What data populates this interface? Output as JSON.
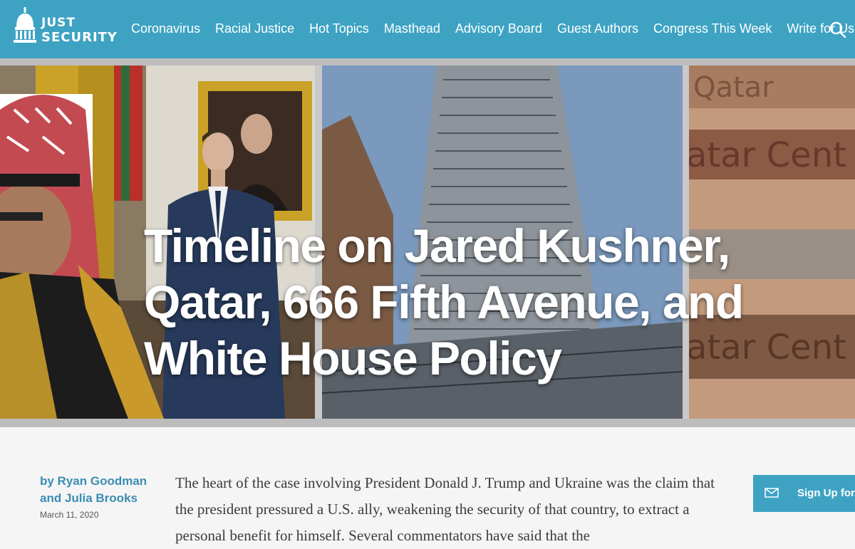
{
  "header": {
    "logo_line1": "JUST",
    "logo_line2": "SECURITY",
    "nav": [
      "Coronavirus",
      "Racial Justice",
      "Hot Topics",
      "Masthead",
      "Advisory Board",
      "Guest Authors",
      "Congress This Week",
      "Write for Us"
    ],
    "search_icon": "search-icon",
    "bar_color": "#3ea3c3"
  },
  "hero": {
    "title": "Timeline on Jared Kushner, Qatar, 666 Fifth Avenue, and White House Policy",
    "panel3_text1": "Qatar",
    "panel3_text2": "atar Cent",
    "panel3_text3": "atar Cent"
  },
  "article": {
    "byline": "by Ryan Goodman and Julia Brooks",
    "date": "March 11, 2020",
    "body": "The heart of the case involving President Donald J. Trump and Ukraine was the claim that the president pressured a U.S. ally, weakening the security of that country, to extract a personal benefit for himself. Several commentators have said that the"
  },
  "signup": {
    "label": "Sign Up for t",
    "icon": "mail-icon"
  }
}
